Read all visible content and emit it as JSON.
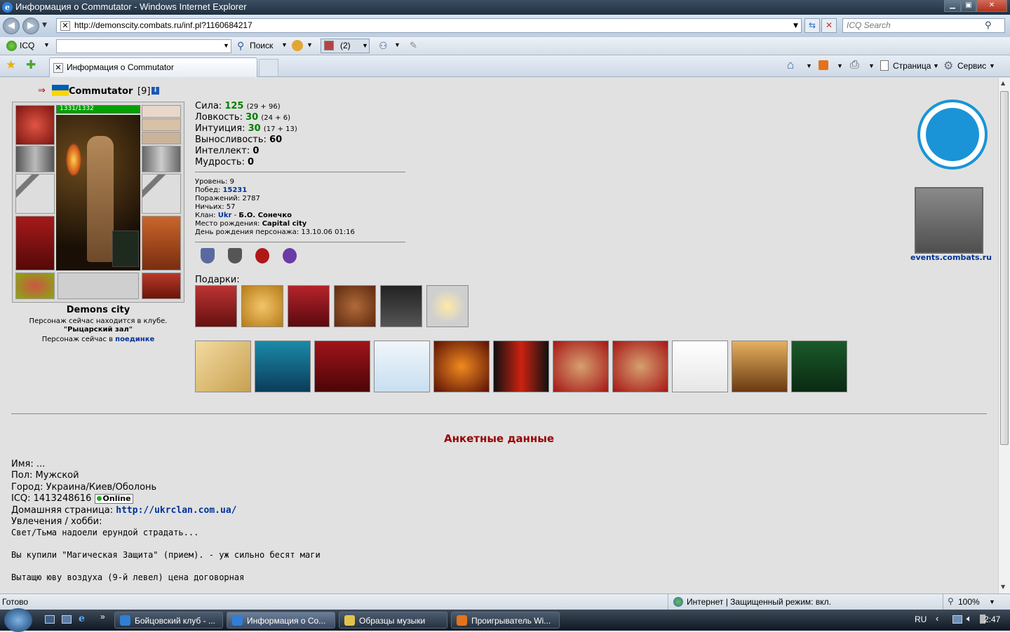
{
  "window": {
    "title": "Информация о Commutator - Windows Internet Explorer"
  },
  "address": {
    "url": "http://demonscity.combats.ru/inf.pl?1160684217",
    "search_placeholder": "ICQ Search"
  },
  "toolbar": {
    "icq": "ICQ",
    "search": "Поиск",
    "counter": "(2)"
  },
  "tabs": [
    {
      "label": "Информация о Commutator"
    }
  ],
  "command_bar": {
    "page": "Страница",
    "service": "Сервис"
  },
  "character": {
    "name": "Commutator",
    "level_badge": "[9]",
    "hp": "1331/1332",
    "hp_fraction": 0.999,
    "city": "Demons city",
    "location_line": "Персонаж сейчас находится в клубе.",
    "location_room": "\"Рыцарский зал\"",
    "battle_prefix": "Персонаж сейчас в",
    "battle_link": "поединке"
  },
  "stats": [
    {
      "label": "Сила:",
      "value": "125",
      "extra": "(29 + 96)",
      "color": "#008000"
    },
    {
      "label": "Ловкость:",
      "value": "30",
      "extra": "(24 + 6)",
      "color": "#008000"
    },
    {
      "label": "Интуиция:",
      "value": "30",
      "extra": "(17 + 13)",
      "color": "#008000"
    },
    {
      "label": "Выносливость:",
      "value": "60",
      "extra": "",
      "color": "#000000"
    },
    {
      "label": "Интеллект:",
      "value": "0",
      "extra": "",
      "color": "#000000"
    },
    {
      "label": "Мудрость:",
      "value": "0",
      "extra": "",
      "color": "#000000"
    }
  ],
  "info": {
    "level": "Уровень: 9",
    "wins_label": "Побед:",
    "wins": "15231",
    "losses": "Поражений: 2787",
    "draws": "Ничьих: 57",
    "clan_label": "Клан:",
    "clan": "Ukr",
    "clan_sep": "-",
    "clan_name": "Б.О. Сонечко",
    "birthplace_label": "Место рождения:",
    "birthplace": "Capital city",
    "birthday": "День рождения персонажа: 13.10.06 01:16"
  },
  "gifts_label": "Подарки:",
  "events_link": "events.combats.ru",
  "profile": {
    "heading": "Анкетные данные",
    "name": "Имя: ...",
    "sex": "Пол: Мужской",
    "city": "Город: Украина/Киев/Оболонь",
    "icq": "ICQ: 1413248616",
    "icq_status": "Online",
    "homepage_label": "Домашняя страница:",
    "homepage": "http://ukrclan.com.ua/",
    "hobby": "Увлечения / хобби:",
    "hobby_lines": [
      "Свет/Тьма надоели ерундой страдать...",
      "Вы купили \"Магическая Защита\" (прием). - уж сильно бесят маги",
      "Вытащю юву воздуха (9-й левел) цена договорная"
    ]
  },
  "status": {
    "left": "Готово",
    "zone": "Интернет | Защищенный режим: вкл.",
    "zoom": "100%"
  },
  "taskbar": {
    "items": [
      "Бойцовский клуб - ...",
      "Информация о Co...",
      "Образцы музыки",
      "Проигрыватель Wi..."
    ],
    "lang": "RU",
    "time": "2:47"
  },
  "colors": {
    "link": "#003399",
    "heading": "#990000",
    "hp_green": "#00a000"
  }
}
